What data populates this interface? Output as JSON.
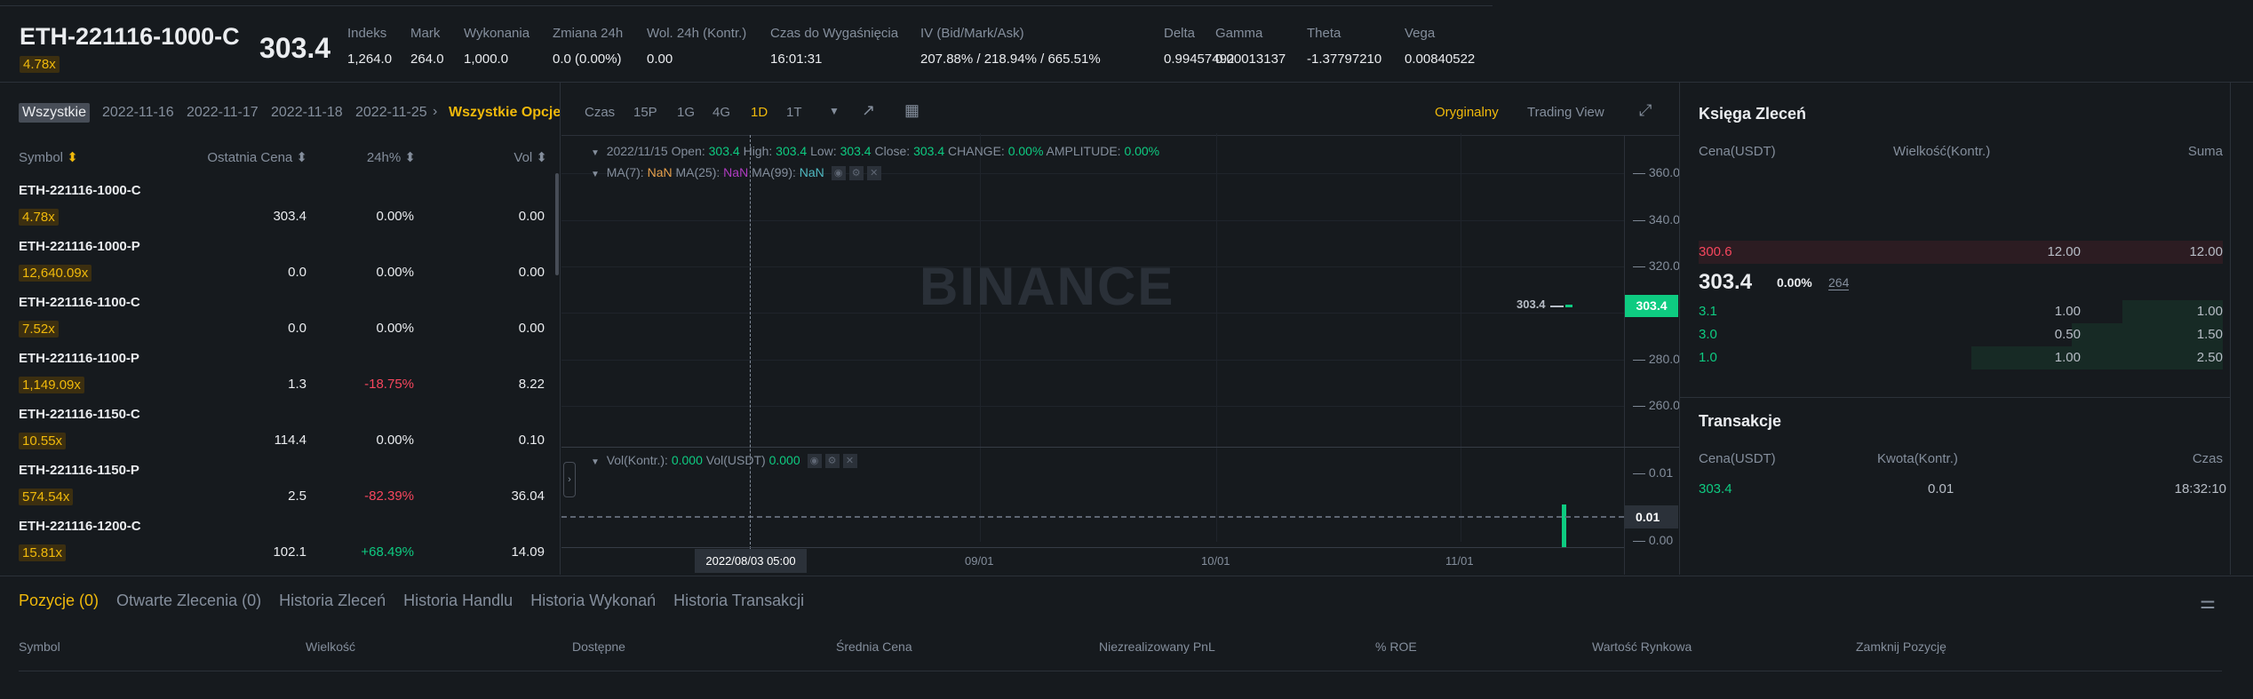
{
  "header": {
    "symbol": "ETH-221116-1000-C",
    "leverage": "4.78x",
    "last_price": "303.4",
    "stats": [
      {
        "label": "Indeks",
        "value": "1,264.0"
      },
      {
        "label": "Mark",
        "value": "264.0"
      },
      {
        "label": "Wykonania",
        "value": "1,000.0"
      },
      {
        "label": "Zmiana 24h",
        "value": "0.0 (0.00%)"
      },
      {
        "label": "Wol. 24h (Kontr.)",
        "value": "0.00"
      },
      {
        "label": "Czas do Wygaśnięcia",
        "value": "16:01:31"
      },
      {
        "label": "IV (Bid/Mark/Ask)",
        "value": "207.88% / 218.94% / 665.51%"
      },
      {
        "label": "Delta",
        "value": "0.99457492"
      },
      {
        "label": "Gamma",
        "value": "0.00013137"
      },
      {
        "label": "Theta",
        "value": "-1.37797210"
      },
      {
        "label": "Vega",
        "value": "0.00840522"
      }
    ]
  },
  "list": {
    "tabs": [
      "Wszystkie",
      "2022-11-16",
      "2022-11-17",
      "2022-11-18",
      "2022-11-25"
    ],
    "all_options": "Wszystkie Opcje",
    "columns": [
      "Symbol",
      "Ostatnia Cena",
      "24h%",
      "Vol"
    ],
    "rows": [
      {
        "symbol": "ETH-221116-1000-C",
        "lev": "4.78x",
        "price": "303.4",
        "change": "0.00%",
        "vol": "0.00",
        "dir": "flat"
      },
      {
        "symbol": "ETH-221116-1000-P",
        "lev": "12,640.09x",
        "price": "0.0",
        "change": "0.00%",
        "vol": "0.00",
        "dir": "flat"
      },
      {
        "symbol": "ETH-221116-1100-C",
        "lev": "7.52x",
        "price": "0.0",
        "change": "0.00%",
        "vol": "0.00",
        "dir": "flat"
      },
      {
        "symbol": "ETH-221116-1100-P",
        "lev": "1,149.09x",
        "price": "1.3",
        "change": "-18.75%",
        "vol": "8.22",
        "dir": "down"
      },
      {
        "symbol": "ETH-221116-1150-C",
        "lev": "10.55x",
        "price": "114.4",
        "change": "0.00%",
        "vol": "0.10",
        "dir": "flat"
      },
      {
        "symbol": "ETH-221116-1150-P",
        "lev": "574.54x",
        "price": "2.5",
        "change": "-82.39%",
        "vol": "36.04",
        "dir": "down"
      },
      {
        "symbol": "ETH-221116-1200-C",
        "lev": "15.81x",
        "price": "102.1",
        "change": "+68.49%",
        "vol": "14.09",
        "dir": "up"
      }
    ]
  },
  "chart": {
    "intervals": [
      "Czas",
      "15P",
      "1G",
      "4G",
      "1D",
      "1T"
    ],
    "active_interval": "1D",
    "view_original": "Oryginalny",
    "view_tv": "Trading View",
    "ohlc": {
      "date": "2022/11/15",
      "open_l": "Open:",
      "open": "303.4",
      "high_l": "High:",
      "high": "303.4",
      "low_l": "Low:",
      "low": "303.4",
      "close_l": "Close:",
      "close": "303.4",
      "change_l": "CHANGE:",
      "change": "0.00%",
      "amp_l": "AMPLITUDE:",
      "amp": "0.00%"
    },
    "ma": {
      "ma7_l": "MA(7):",
      "ma7": "NaN",
      "ma25_l": "MA(25):",
      "ma25": "NaN",
      "ma99_l": "MA(99):",
      "ma99": "NaN"
    },
    "vol": {
      "k_l": "Vol(Kontr.):",
      "k": "0.000",
      "u_l": "Vol(USDT)",
      "u": "0.000"
    },
    "watermark": "BINANCE",
    "crosshair_time": "2022/08/03 05:00"
  },
  "chart_data": {
    "type": "candlestick",
    "price_ticks": [
      "360.0",
      "340.0",
      "320.0",
      "280.0",
      "260.0"
    ],
    "price_range": [
      252,
      372
    ],
    "last_price_label": "303.4",
    "candle_label": "303.4",
    "candles": [
      {
        "date": "2022/11/15",
        "open": 303.4,
        "high": 303.4,
        "low": 303.4,
        "close": 303.4
      }
    ],
    "volume_ticks": [
      "0.01",
      "0.00"
    ],
    "volume_current": "0.01",
    "volumes": [
      0.01
    ],
    "x_ticks": [
      "09/01",
      "10/01",
      "11/01"
    ],
    "colors": {
      "up": "#0ecb81",
      "down": "#f6465d"
    }
  },
  "orderbook": {
    "title": "Księga Zleceń",
    "cols": [
      "Cena(USDT)",
      "Wielkość(Kontr.)",
      "Suma"
    ],
    "asks": [
      {
        "price": "300.6",
        "size": "12.00",
        "sum": "12.00",
        "depth": 1
      }
    ],
    "mid": {
      "price": "303.4",
      "change": "0.00%",
      "mark": "264"
    },
    "bids": [
      {
        "price": "3.1",
        "size": "1.00",
        "sum": "1.00",
        "depth": 0.4
      },
      {
        "price": "3.0",
        "size": "0.50",
        "sum": "1.50",
        "depth": 0.6
      },
      {
        "price": "1.0",
        "size": "1.00",
        "sum": "2.50",
        "depth": 1
      }
    ]
  },
  "trades": {
    "title": "Transakcje",
    "cols": [
      "Cena(USDT)",
      "Kwota(Kontr.)",
      "Czas"
    ],
    "rows": [
      {
        "price": "303.4",
        "amount": "0.01",
        "time": "18:32:10"
      }
    ]
  },
  "bottom": {
    "tabs": [
      "Pozycje (0)",
      "Otwarte Zlecenia (0)",
      "Historia Zleceń",
      "Historia Handlu",
      "Historia Wykonań",
      "Historia Transakcji"
    ],
    "cols": [
      "Symbol",
      "Wielkość",
      "Dostępne",
      "Średnia Cena",
      "Niezrealizowany PnL",
      "% ROE",
      "Wartość Rynkowa",
      "Zamknij Pozycję"
    ]
  }
}
